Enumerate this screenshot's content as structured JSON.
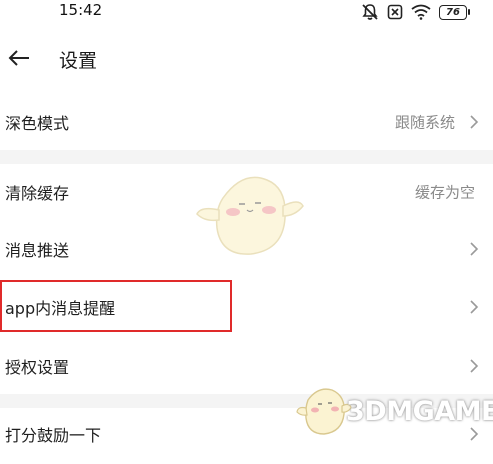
{
  "status_bar": {
    "time": "15:42",
    "battery": "76"
  },
  "header": {
    "title": "设置"
  },
  "settings": [
    {
      "label": "深色模式",
      "value": "跟随系统",
      "chevron": true
    },
    {
      "label": "清除缓存",
      "value": "缓存为空",
      "chevron": false
    },
    {
      "label": "消息推送",
      "value": "",
      "chevron": true
    },
    {
      "label": "app内消息提醒",
      "value": "",
      "chevron": true
    },
    {
      "label": "授权设置",
      "value": "",
      "chevron": true
    },
    {
      "label": "打分鼓励一下",
      "value": "",
      "chevron": true
    }
  ],
  "watermark": {
    "text": "3DMGAME"
  },
  "colors": {
    "highlight": "#e02a2a",
    "divider": "#f4f4f4",
    "secondary_text": "#8a8a8a"
  }
}
